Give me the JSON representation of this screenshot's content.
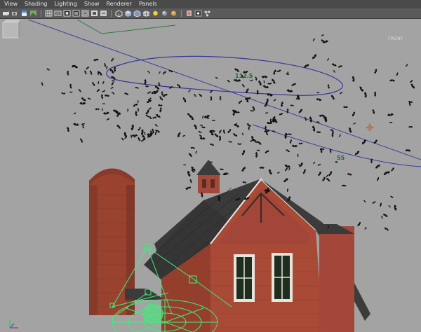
{
  "menubar": {
    "items": [
      {
        "label": "View"
      },
      {
        "label": "Shading"
      },
      {
        "label": "Lighting"
      },
      {
        "label": "Show"
      },
      {
        "label": "Renderer"
      },
      {
        "label": "Panels"
      }
    ]
  },
  "toolbar": {
    "icons": [
      "camera-select-icon",
      "camera-attr-icon",
      "bookmark-icon",
      "image-plane-icon",
      "grid-icon",
      "film-gate-icon",
      "resolution-gate-icon",
      "gate-mask-icon",
      "field-chart-icon",
      "safe-action-icon",
      "safe-title-icon",
      "wireframe-icon",
      "smooth-shade-icon",
      "wireframe-on-shaded-icon",
      "textured-icon",
      "use-all-lights-icon",
      "shadows-icon",
      "isolate-select-icon",
      "xray-icon",
      "xray-joints-icon"
    ]
  },
  "viewport": {
    "curve_labels": {
      "upper": "112.5",
      "lower": "55"
    },
    "view_cube_label": "FRONT",
    "colors": {
      "background": "#a3a3a3",
      "curve": "#38389a",
      "rig": "#3cf07a",
      "brick": "#a84a36",
      "roof": "#3a3a3a"
    }
  }
}
